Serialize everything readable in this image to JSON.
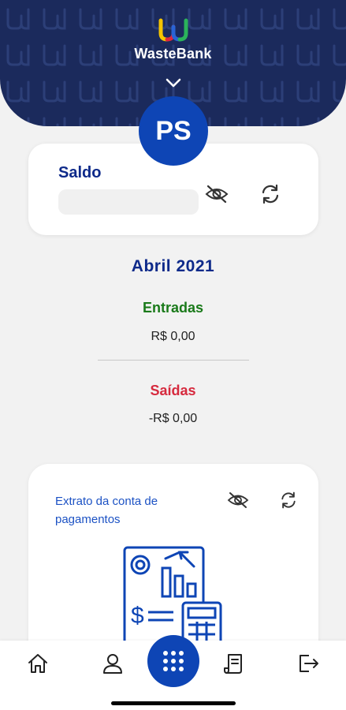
{
  "header": {
    "brand": "WasteBank",
    "colors": {
      "background": "#1b2a5c",
      "logo_yellow": "#f5c400",
      "logo_red": "#e0263b",
      "logo_blue": "#2a64d6",
      "logo_green": "#2bb35b"
    }
  },
  "avatar": {
    "initials": "PS",
    "color": "#0e45b5"
  },
  "balance_card": {
    "title": "Saldo",
    "eye_icon": "eye-off-icon",
    "refresh_icon": "refresh-icon"
  },
  "summary": {
    "month": "Abril 2021",
    "income_label": "Entradas",
    "income_value": "R$ 0,00",
    "income_color": "#1a7a1a",
    "expense_label": "Saídas",
    "expense_value": "-R$ 0,00",
    "expense_color": "#d62a3e"
  },
  "statement_card": {
    "title": "Extrato da conta de pagamentos",
    "eye_icon": "eye-off-icon",
    "refresh_icon": "refresh-icon",
    "illustration": "statement-illustration"
  },
  "bottom_nav": {
    "items": [
      "home-icon",
      "profile-icon",
      "menu-grid-icon",
      "document-icon",
      "logout-icon"
    ]
  }
}
